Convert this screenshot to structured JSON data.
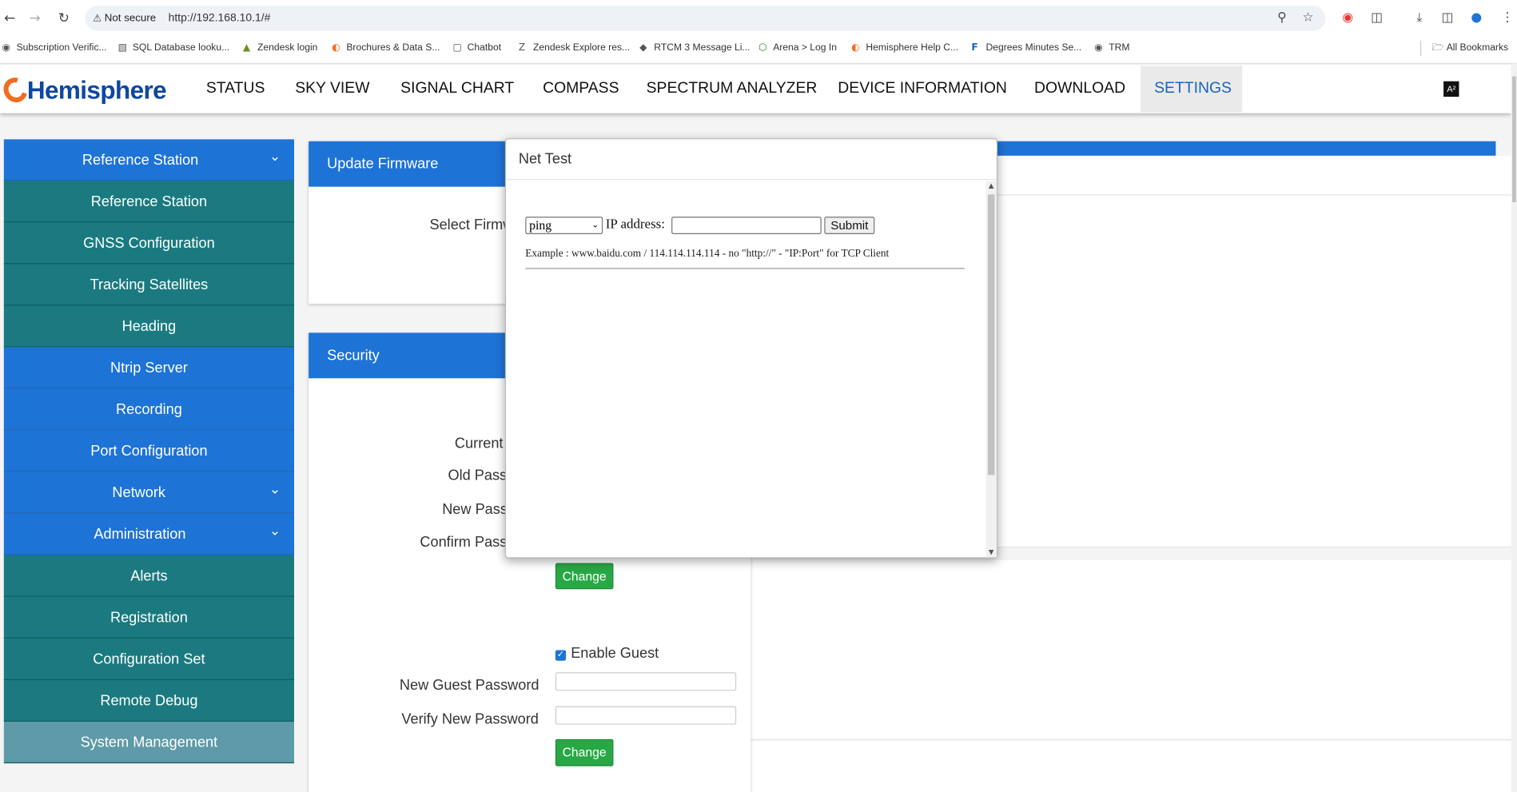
{
  "browser": {
    "security": "Not secure",
    "url": "http://192.168.10.1/#",
    "bookmarks": [
      {
        "label": "Subscription Verific...",
        "icon": "globe-icon"
      },
      {
        "label": "SQL Database looku...",
        "icon": "chart-icon"
      },
      {
        "label": "Zendesk login",
        "icon": "zendesk-icon"
      },
      {
        "label": "Brochures & Data S...",
        "icon": "hemisphere-icon"
      },
      {
        "label": "Chatbot",
        "icon": "chatbot-icon"
      },
      {
        "label": "Zendesk Explore res...",
        "icon": "zendesk-explore-icon"
      },
      {
        "label": "RTCM 3 Message Li...",
        "icon": "rtcm-icon"
      },
      {
        "label": "Arena > Log In",
        "icon": "arena-icon"
      },
      {
        "label": "Hemisphere Help C...",
        "icon": "hemisphere-icon"
      },
      {
        "label": "Degrees Minutes Se...",
        "icon": "fcc-icon"
      },
      {
        "label": "TRM",
        "icon": "globe-icon"
      }
    ],
    "all_bookmarks": "All Bookmarks"
  },
  "app": {
    "logo": "Hemisphere",
    "nav": [
      "STATUS",
      "SKY VIEW",
      "SIGNAL CHART",
      "COMPASS",
      "SPECTRUM ANALYZER",
      "DEVICE INFORMATION",
      "DOWNLOAD",
      "SETTINGS"
    ],
    "active_nav": "SETTINGS"
  },
  "sidebar": {
    "items": [
      {
        "label": "Reference Station",
        "style": "blue",
        "group": true
      },
      {
        "label": "Reference Station",
        "style": "teal"
      },
      {
        "label": "GNSS Configuration",
        "style": "teal"
      },
      {
        "label": "Tracking Satellites",
        "style": "teal"
      },
      {
        "label": "Heading",
        "style": "teal"
      },
      {
        "label": "Ntrip Server",
        "style": "blue"
      },
      {
        "label": "Recording",
        "style": "blue"
      },
      {
        "label": "Port Configuration",
        "style": "blue"
      },
      {
        "label": "Network",
        "style": "blue",
        "group": true
      },
      {
        "label": "Administration",
        "style": "blue",
        "group": true
      },
      {
        "label": "Alerts",
        "style": "teal"
      },
      {
        "label": "Registration",
        "style": "teal"
      },
      {
        "label": "Configuration Set",
        "style": "teal"
      },
      {
        "label": "Remote Debug",
        "style": "teal"
      },
      {
        "label": "System Management",
        "style": "gray"
      }
    ]
  },
  "firmware": {
    "title": "Update Firmware",
    "select_label": "Select Firmware"
  },
  "security": {
    "title": "Security",
    "current_label": "Current",
    "old_pass_label": "Old Password",
    "new_pass_label": "New Password",
    "confirm_pass_label": "Confirm Password",
    "change_label": "Change",
    "enable_guest_label": "Enable Guest",
    "enable_guest_checked": true,
    "guest_pass_label": "New Guest Password",
    "verify_pass_label": "Verify New Password",
    "guest_change_label": "Change"
  },
  "modal": {
    "title": "Net Test",
    "tool_selected": "ping",
    "ip_label": "IP address:",
    "ip_value": "",
    "submit_label": "Submit",
    "example": "Example : www.baidu.com / 114.114.114.114 - no \"http://\" - \"IP:Port\" for TCP Client"
  }
}
